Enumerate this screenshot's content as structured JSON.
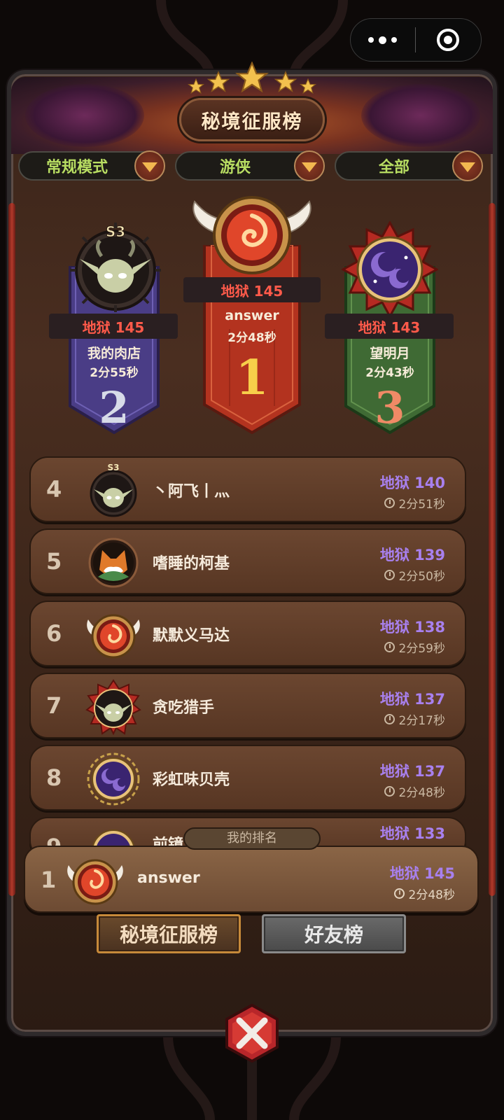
{
  "header": {
    "title": "秘境征服榜",
    "stars": 5
  },
  "filters": [
    {
      "label": "常规模式"
    },
    {
      "label": "游侠"
    },
    {
      "label": "全部"
    }
  ],
  "podium": [
    {
      "rank": "2",
      "score": "地狱 145",
      "name": "我的肉店",
      "time": "2分55秒",
      "badge": "S3",
      "avatar_icon": "goblin-avatar-icon"
    },
    {
      "rank": "1",
      "score": "地狱 145",
      "name": "answer",
      "time": "2分48秒",
      "badge": "",
      "avatar_icon": "fire-orb-avatar-icon"
    },
    {
      "rank": "3",
      "score": "地狱 143",
      "name": "望明月",
      "time": "2分43秒",
      "badge": "",
      "avatar_icon": "moon-avatar-icon"
    }
  ],
  "list": [
    {
      "rank": "4",
      "name": "丶阿飞丨灬",
      "score": "地狱 140",
      "time": "2分51秒",
      "badge": "S3",
      "avatar_icon": "goblin-avatar-icon"
    },
    {
      "rank": "5",
      "name": "嗜睡的柯基",
      "score": "地狱 139",
      "time": "2分50秒",
      "badge": "",
      "avatar_icon": "fox-avatar-icon"
    },
    {
      "rank": "6",
      "name": "默默义马达",
      "score": "地狱 138",
      "time": "2分59秒",
      "badge": "",
      "avatar_icon": "fire-orb-avatar-icon"
    },
    {
      "rank": "7",
      "name": "贪吃猎手",
      "score": "地狱 137",
      "time": "2分17秒",
      "badge": "",
      "avatar_icon": "goblin-avatar-icon"
    },
    {
      "rank": "8",
      "name": "彩虹味贝壳",
      "score": "地狱 137",
      "time": "2分48秒",
      "badge": "",
      "avatar_icon": "moon-avatar-icon"
    },
    {
      "rank": "9",
      "name": "前镜",
      "score": "地狱 133",
      "time": "",
      "badge": "",
      "avatar_icon": "moon-avatar-icon"
    }
  ],
  "my_rank": {
    "tab_label": "我的排名",
    "rank": "1",
    "name": "answer",
    "score": "地狱 145",
    "time": "2分48秒",
    "avatar_icon": "fire-orb-avatar-icon"
  },
  "tabs": [
    {
      "label": "秘境征服榜",
      "active": true
    },
    {
      "label": "好友榜",
      "active": false
    }
  ],
  "colors": {
    "score_purple": "#a880ee",
    "score_red": "#ff5a4a",
    "filter_green": "#b8dd62",
    "gold": "#f2c14e"
  }
}
